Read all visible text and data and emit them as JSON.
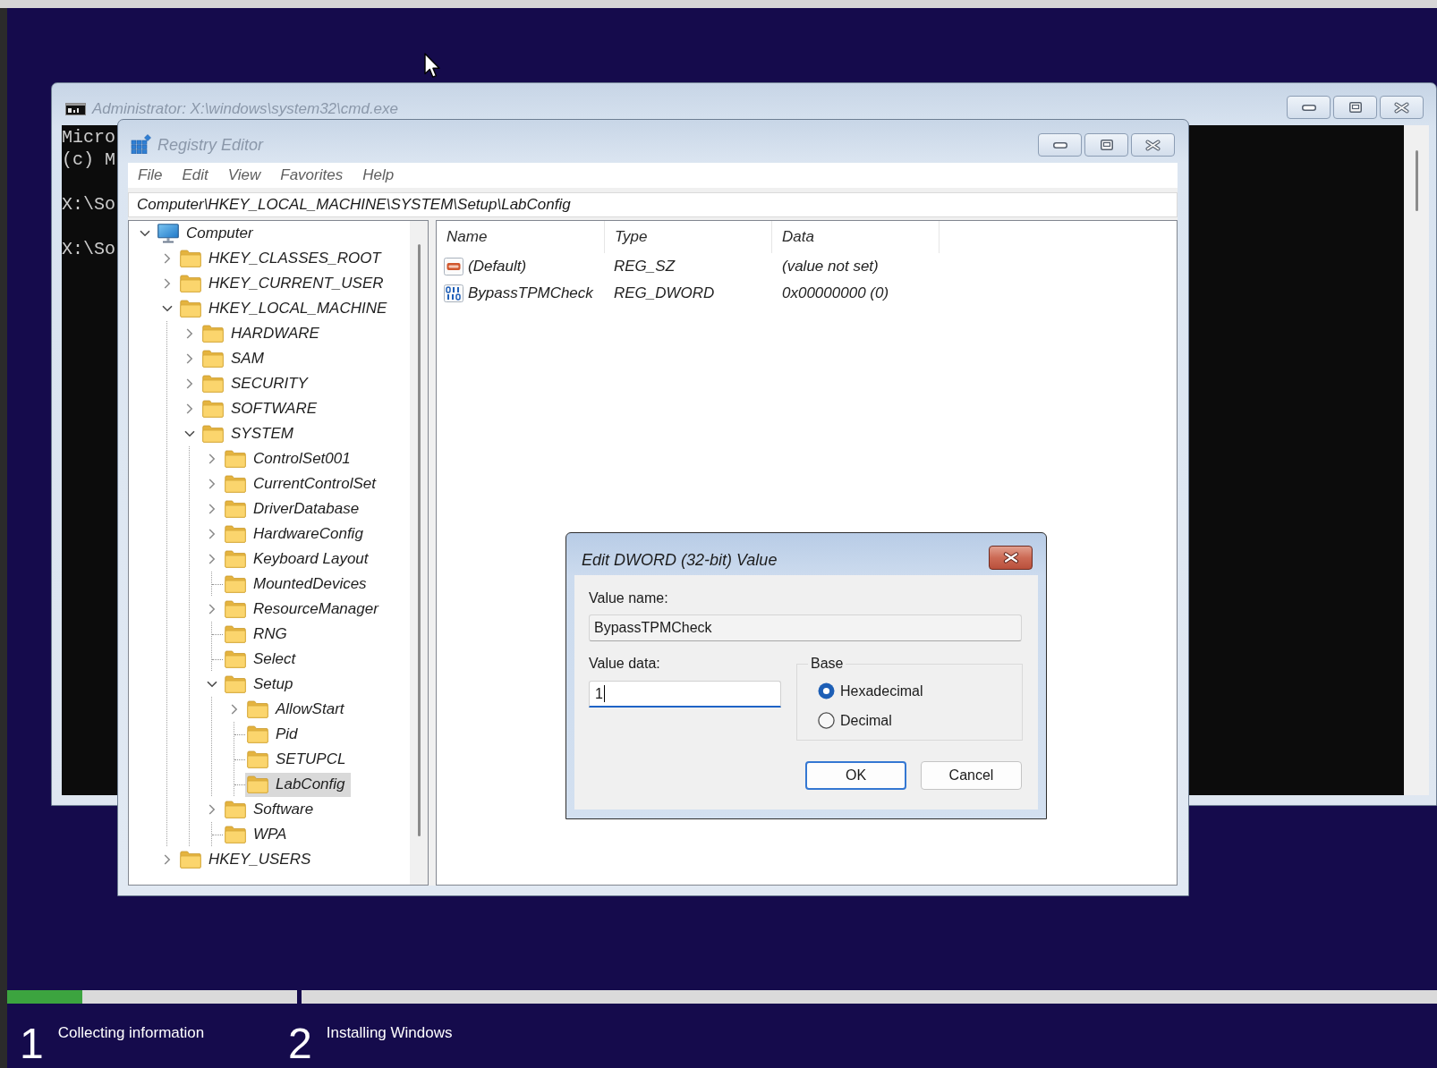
{
  "console_window": {
    "title": "Administrator: X:\\windows\\system32\\cmd.exe",
    "active": false,
    "paragraphs": [
      [
        "Micro",
        "(c) M"
      ],
      [
        "X:\\So"
      ],
      [
        "X:\\So"
      ]
    ]
  },
  "registry_editor": {
    "title": "Registry Editor",
    "active": false,
    "menu": [
      "File",
      "Edit",
      "View",
      "Favorites",
      "Help"
    ],
    "address": "Computer\\HKEY_LOCAL_MACHINE\\SYSTEM\\Setup\\LabConfig",
    "tree": [
      {
        "label": "Computer",
        "kind": "computer",
        "expanded": true,
        "selected": false,
        "children": [
          {
            "label": "HKEY_CLASSES_ROOT",
            "kind": "folder",
            "expanded": false,
            "selected": false
          },
          {
            "label": "HKEY_CURRENT_USER",
            "kind": "folder",
            "expanded": false,
            "selected": false
          },
          {
            "label": "HKEY_LOCAL_MACHINE",
            "kind": "folder",
            "expanded": true,
            "selected": false,
            "children": [
              {
                "label": "HARDWARE",
                "kind": "folder",
                "expanded": false,
                "selected": false
              },
              {
                "label": "SAM",
                "kind": "folder",
                "expanded": false,
                "selected": false
              },
              {
                "label": "SECURITY",
                "kind": "folder",
                "expanded": false,
                "selected": false
              },
              {
                "label": "SOFTWARE",
                "kind": "folder",
                "expanded": false,
                "selected": false
              },
              {
                "label": "SYSTEM",
                "kind": "folder",
                "expanded": true,
                "selected": false,
                "children": [
                  {
                    "label": "ControlSet001",
                    "kind": "folder",
                    "expanded": false,
                    "selected": false
                  },
                  {
                    "label": "CurrentControlSet",
                    "kind": "folder",
                    "expanded": false,
                    "selected": false
                  },
                  {
                    "label": "DriverDatabase",
                    "kind": "folder",
                    "expanded": false,
                    "selected": false
                  },
                  {
                    "label": "HardwareConfig",
                    "kind": "folder",
                    "expanded": false,
                    "selected": false
                  },
                  {
                    "label": "Keyboard Layout",
                    "kind": "folder",
                    "expanded": false,
                    "selected": false
                  },
                  {
                    "label": "MountedDevices",
                    "kind": "folder",
                    "selected": false
                  },
                  {
                    "label": "ResourceManager",
                    "kind": "folder",
                    "expanded": false,
                    "selected": false
                  },
                  {
                    "label": "RNG",
                    "kind": "folder",
                    "selected": false
                  },
                  {
                    "label": "Select",
                    "kind": "folder",
                    "selected": false
                  },
                  {
                    "label": "Setup",
                    "kind": "folder",
                    "expanded": true,
                    "selected": false,
                    "children": [
                      {
                        "label": "AllowStart",
                        "kind": "folder",
                        "expanded": false,
                        "selected": false
                      },
                      {
                        "label": "Pid",
                        "kind": "folder",
                        "selected": false
                      },
                      {
                        "label": "SETUPCL",
                        "kind": "folder",
                        "selected": false
                      },
                      {
                        "label": "LabConfig",
                        "kind": "folder",
                        "selected": true
                      }
                    ]
                  },
                  {
                    "label": "Software",
                    "kind": "folder",
                    "expanded": false,
                    "selected": false
                  },
                  {
                    "label": "WPA",
                    "kind": "folder",
                    "selected": false
                  }
                ]
              }
            ]
          },
          {
            "label": "HKEY_USERS",
            "kind": "folder",
            "expanded": false,
            "selected": false
          }
        ]
      }
    ],
    "columns": [
      "Name",
      "Type",
      "Data"
    ],
    "values": [
      {
        "name": "(Default)",
        "type": "REG_SZ",
        "data": "(value not set)",
        "kind": "string"
      },
      {
        "name": "BypassTPMCheck",
        "type": "REG_DWORD",
        "data": "0x00000000 (0)",
        "kind": "dword"
      }
    ]
  },
  "dialog": {
    "title": "Edit DWORD (32-bit) Value",
    "active": true,
    "value_name_label": "Value name:",
    "value_name": {
      "value": "BypassTPMCheck",
      "read_only": true
    },
    "value_data_label": "Value data:",
    "value_data": {
      "value": "1",
      "focused": true
    },
    "base": {
      "label": "Base",
      "options": [
        {
          "label": "Hexadecimal",
          "selected": true
        },
        {
          "label": "Decimal",
          "selected": false
        }
      ]
    },
    "buttons": [
      {
        "label": "OK",
        "default": true
      },
      {
        "label": "Cancel",
        "default": false
      }
    ]
  },
  "setup": {
    "steps": [
      {
        "number": "1",
        "label": "Collecting information",
        "level": 0.26
      },
      {
        "number": "2",
        "label": "Installing Windows"
      }
    ]
  }
}
